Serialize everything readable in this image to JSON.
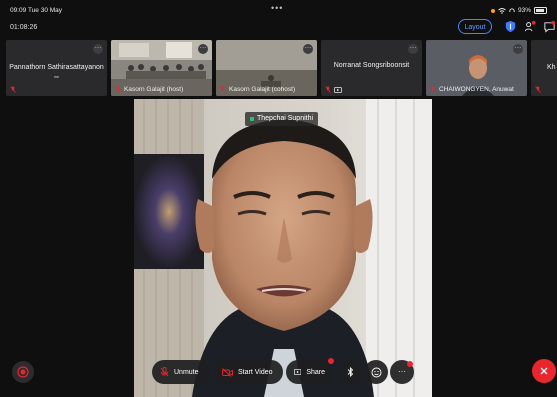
{
  "status_bar": {
    "time_date": "09:09  Tue 30 May",
    "battery": "93%"
  },
  "meeting": {
    "elapsed": "01:08:26",
    "layout_label": "Layout"
  },
  "participants": [
    {
      "name": "Pannathorn Sathirasattayanon",
      "sub": "me",
      "video": false
    },
    {
      "name": "Kasorn Galajit (host)",
      "video": true
    },
    {
      "name": "Kasorn Galajit (cohost)",
      "video": true
    },
    {
      "name": "Norranat Songsriboonsit",
      "video": false
    },
    {
      "name": "CHAIWONGYEN, Anuwat",
      "video": true
    },
    {
      "name": "Kh",
      "video": false
    }
  ],
  "active_speaker": {
    "name": "Thepchai Supnithi"
  },
  "controls": {
    "unmute": "Unmute",
    "start_video": "Start Video",
    "share": "Share"
  },
  "icons": [
    "record-icon",
    "mic-off-icon",
    "video-off-icon",
    "share-screen-icon",
    "bluetooth-icon",
    "emoji-icon",
    "more-icon",
    "close-icon",
    "shield-icon",
    "people-icon",
    "chat-icon"
  ],
  "colors": {
    "accent": "#4a86ff",
    "danger": "#e8262e",
    "background": "#0f0f10"
  }
}
